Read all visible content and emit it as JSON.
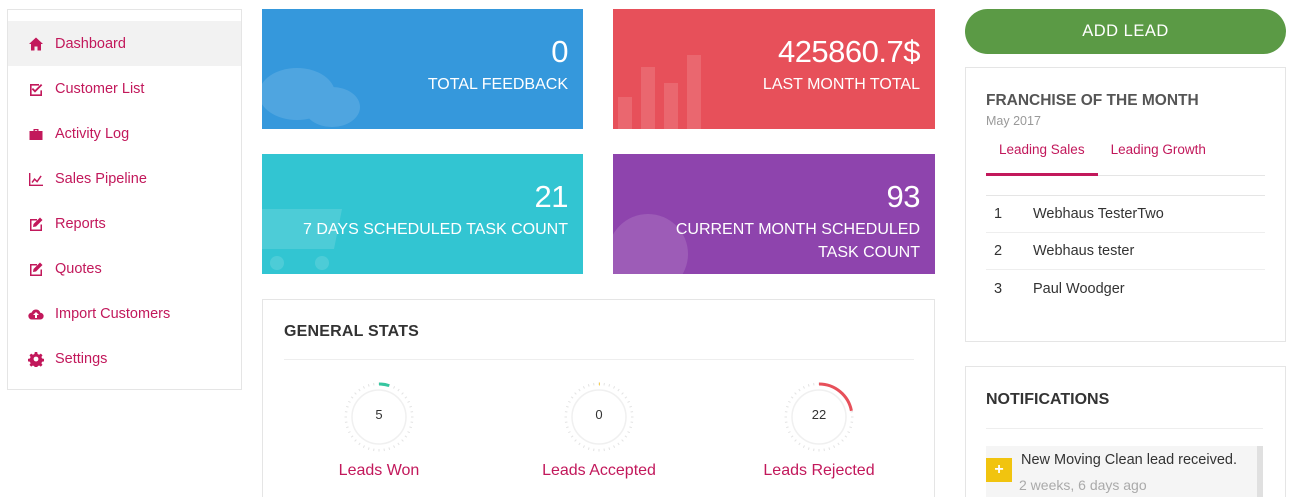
{
  "sidebar": {
    "items": [
      {
        "label": "Dashboard",
        "icon": "home-icon"
      },
      {
        "label": "Customer List",
        "icon": "check-square-icon"
      },
      {
        "label": "Activity Log",
        "icon": "briefcase-icon"
      },
      {
        "label": "Sales Pipeline",
        "icon": "line-chart-icon"
      },
      {
        "label": "Reports",
        "icon": "edit-icon"
      },
      {
        "label": "Quotes",
        "icon": "edit-icon"
      },
      {
        "label": "Import Customers",
        "icon": "cloud-upload-icon"
      },
      {
        "label": "Settings",
        "icon": "gear-icon"
      }
    ]
  },
  "tiles": [
    {
      "value": "0",
      "label": "TOTAL FEEDBACK",
      "color": "#3598dc",
      "icon": "comments-icon"
    },
    {
      "value": "425860.7$",
      "label": "LAST MONTH TOTAL",
      "color": "#e7505a",
      "icon": "bar-chart-icon"
    },
    {
      "value": "21",
      "label": "7 DAYS SCHEDULED TASK COUNT",
      "color": "#32c5d2",
      "icon": "shopping-cart-icon"
    },
    {
      "value": "93",
      "label": "CURRENT MONTH SCHEDULED TASK COUNT",
      "color": "#8e44ad",
      "icon": "globe-icon"
    }
  ],
  "general_stats": {
    "title": "GENERAL STATS",
    "gauges": [
      {
        "value": "5",
        "label": "Leads Won",
        "fraction": 0.05,
        "color": "#36c6a0"
      },
      {
        "value": "0",
        "label": "Leads Accepted",
        "fraction": 0.0,
        "color": "#f4c430"
      },
      {
        "value": "22",
        "label": "Leads Rejected",
        "fraction": 0.22,
        "color": "#e7505a"
      }
    ]
  },
  "add_lead": {
    "label": "ADD LEAD",
    "color": "#5b9a45"
  },
  "franchise": {
    "title": "FRANCHISE OF THE MONTH",
    "subtitle": "May 2017",
    "tabs": [
      "Leading Sales",
      "Leading Growth"
    ],
    "active_tab": "Leading Sales",
    "rows": [
      {
        "rank": "1",
        "name": "Webhaus TesterTwo"
      },
      {
        "rank": "2",
        "name": "Webhaus tester"
      },
      {
        "rank": "3",
        "name": "Paul Woodger"
      }
    ]
  },
  "notifications": {
    "title": "NOTIFICATIONS",
    "items": [
      {
        "text": "New Moving Clean lead received.",
        "time": "2 weeks, 6 days ago",
        "icon": "plus-icon"
      }
    ]
  },
  "accent_color": "#c2185b"
}
